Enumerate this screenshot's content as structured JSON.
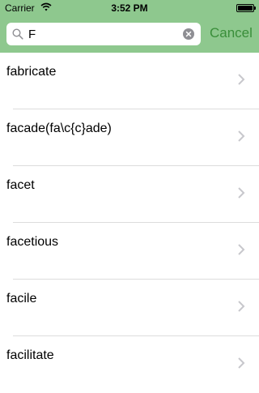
{
  "status_bar": {
    "carrier": "Carrier",
    "time": "3:52 PM",
    "wifi_icon": "wifi-icon",
    "battery_icon": "battery-icon"
  },
  "search": {
    "value": "F",
    "search_icon": "search-icon",
    "clear_icon": "clear-icon",
    "cancel_label": "Cancel"
  },
  "colors": {
    "header_bg": "#8ec88e",
    "accent": "#3a8e3a"
  },
  "results": [
    {
      "label": "fabricate"
    },
    {
      "label": "facade(fa\\c{c}ade)"
    },
    {
      "label": "facet"
    },
    {
      "label": "facetious"
    },
    {
      "label": "facile"
    },
    {
      "label": "facilitate"
    }
  ]
}
